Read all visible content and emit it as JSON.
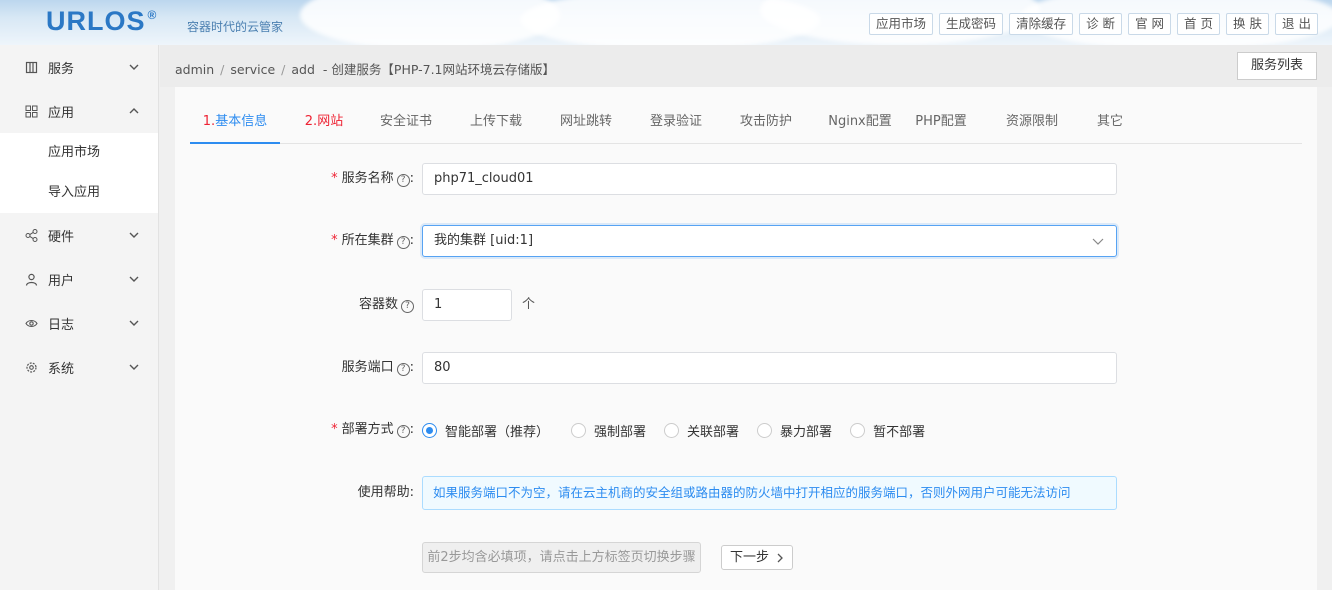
{
  "header": {
    "logo": "URLOS",
    "logo_mark": "®",
    "slogan": "容器时代的云管家",
    "links": [
      "应用市场",
      "生成密码",
      "清除缓存",
      "诊 断",
      "官 网",
      "首 页",
      "换 肤",
      "退 出"
    ]
  },
  "sidebar": {
    "items": [
      {
        "label": "服务",
        "icon": "book-icon",
        "expanded": false
      },
      {
        "label": "应用",
        "icon": "grid-icon",
        "expanded": true,
        "children": [
          "应用市场",
          "导入应用"
        ]
      },
      {
        "label": "硬件",
        "icon": "share-nodes-icon",
        "expanded": false
      },
      {
        "label": "用户",
        "icon": "user-icon",
        "expanded": false
      },
      {
        "label": "日志",
        "icon": "eye-icon",
        "expanded": false
      },
      {
        "label": "系统",
        "icon": "gear-icon",
        "expanded": false
      }
    ]
  },
  "breadcrumb": {
    "items": [
      "admin",
      "service",
      "add"
    ],
    "separator": "/",
    "dash": "-",
    "title": "创建服务【PHP-7.1网站环境云存储版】"
  },
  "service_list_button": "服务列表",
  "tabs": [
    {
      "label": "基本信息",
      "prefix": "1.",
      "active": true
    },
    {
      "label": "网站",
      "prefix": "2.",
      "required": true
    },
    {
      "label": "安全证书"
    },
    {
      "label": "上传下载"
    },
    {
      "label": "网址跳转"
    },
    {
      "label": "登录验证"
    },
    {
      "label": "攻击防护"
    },
    {
      "label": "Nginx配置"
    },
    {
      "label": "PHP配置"
    },
    {
      "label": "资源限制"
    },
    {
      "label": "其它"
    }
  ],
  "form": {
    "service_name": {
      "label": "服务名称",
      "colon": ":",
      "value": "php71_cloud01",
      "required": true
    },
    "cluster": {
      "label": "所在集群",
      "colon": ":",
      "value": "我的集群 [uid:1]",
      "required": true
    },
    "containers": {
      "label": "容器数",
      "value": "1",
      "unit": "个"
    },
    "port": {
      "label": "服务端口",
      "colon": ":",
      "value": "80"
    },
    "deploy": {
      "label": "部署方式",
      "colon": ":",
      "required": true,
      "options": [
        "智能部署（推荐）",
        "强制部署",
        "关联部署",
        "暴力部署",
        "暂不部署"
      ],
      "selected": 0
    },
    "help": {
      "label": "使用帮助:",
      "text": "如果服务端口不为空，请在云主机商的安全组或路由器的防火墙中打开相应的服务端口，否则外网用户可能无法访问"
    },
    "hint_button": "前2步均含必填项，请点击上方标签页切换步骤",
    "next_button": "下一步"
  },
  "colors": {
    "accent": "#2d8cf0",
    "required": "#ee2233",
    "logo": "#2b78c5"
  }
}
